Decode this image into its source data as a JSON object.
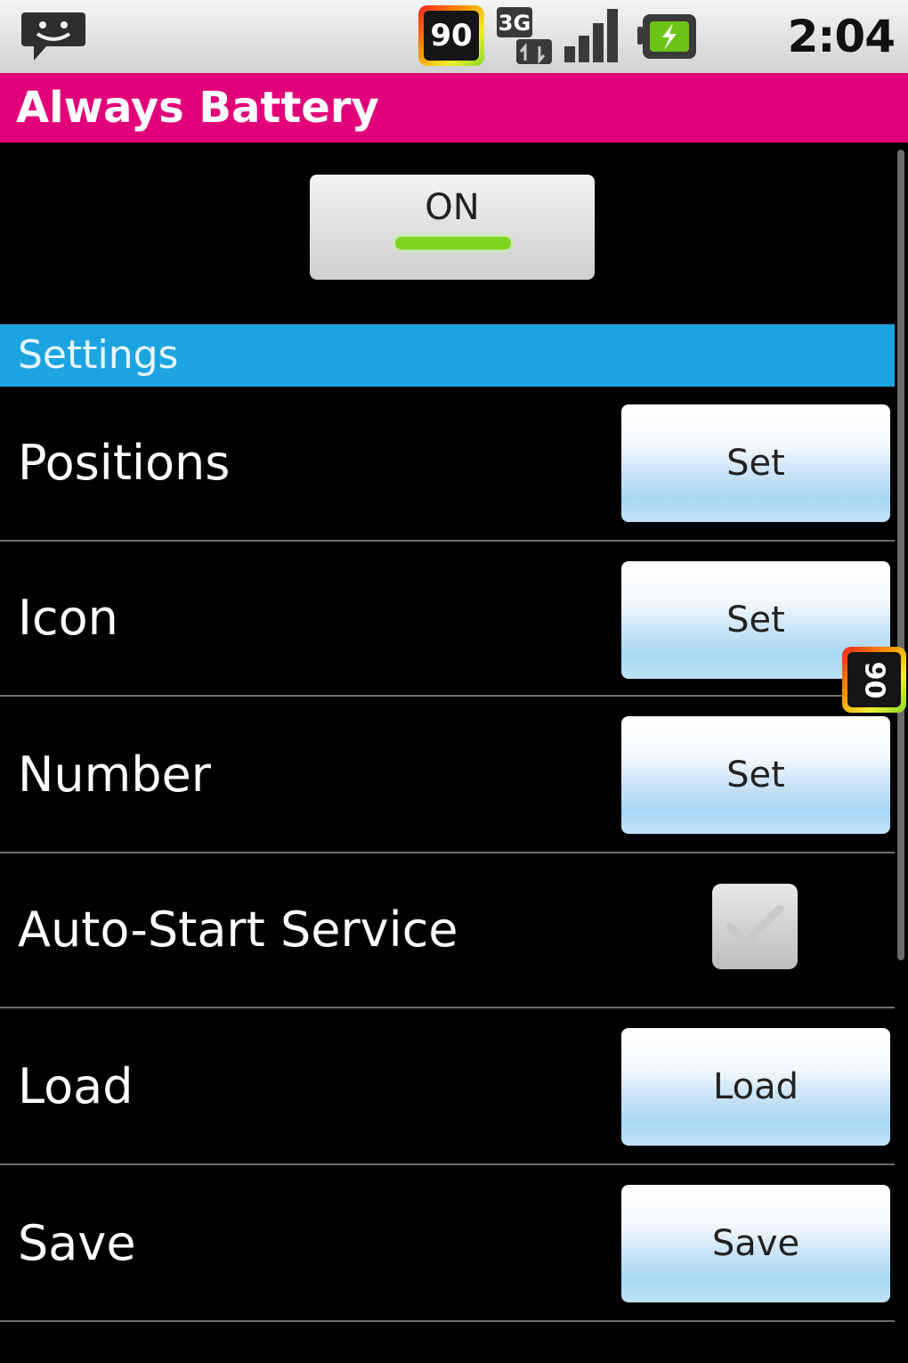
{
  "status_bar": {
    "battery_percent": "90",
    "network": "3G",
    "time": "2:04 AM"
  },
  "app": {
    "title": "Always Battery"
  },
  "master_toggle": {
    "label": "ON",
    "state": true,
    "indicator_color": "#7ed321"
  },
  "settings": {
    "header": "Settings",
    "rows": [
      {
        "label": "Positions",
        "control": "button",
        "button_label": "Set"
      },
      {
        "label": "Icon",
        "control": "button",
        "button_label": "Set"
      },
      {
        "label": "Number",
        "control": "button",
        "button_label": "Set"
      },
      {
        "label": "Auto-Start Service",
        "control": "checkbox",
        "checked": false
      },
      {
        "label": "Load",
        "control": "button",
        "button_label": "Load"
      },
      {
        "label": "Save",
        "control": "button",
        "button_label": "Save"
      }
    ]
  },
  "overlay": {
    "battery_tag": "90"
  },
  "colors": {
    "title_bar": "#e2007a",
    "section_header": "#1ba4e0",
    "background": "#000000"
  }
}
